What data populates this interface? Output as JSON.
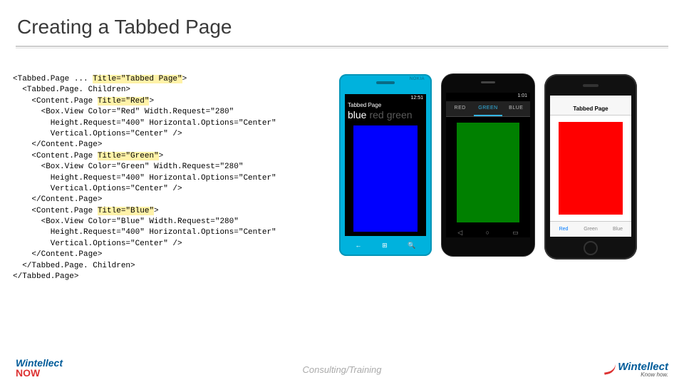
{
  "slide": {
    "title": "Creating a Tabbed Page"
  },
  "code": {
    "l1a": "<Tabbed.Page ... ",
    "l1b": "Title=\"Tabbed Page\"",
    "l1c": ">",
    "l2": "  <Tabbed.Page. Children>",
    "l3a": "    <Content.Page ",
    "l3b": "Title=\"Red\"",
    "l3c": ">",
    "l4": "      <Box.View Color=\"Red\" Width.Request=\"280\"",
    "l5": "        Height.Request=\"400\" Horizontal.Options=\"Center\"",
    "l6": "        Vertical.Options=\"Center\" />",
    "l7": "    </Content.Page>",
    "l8a": "    <Content.Page ",
    "l8b": "Title=\"Green\"",
    "l8c": ">",
    "l9": "      <Box.View Color=\"Green\" Width.Request=\"280\"",
    "l10": "        Height.Request=\"400\" Horizontal.Options=\"Center\"",
    "l11": "        Vertical.Options=\"Center\" />",
    "l12": "    </Content.Page>",
    "l13a": "    <Content.Page ",
    "l13b": "Title=\"Blue\"",
    "l13c": ">",
    "l14": "      <Box.View Color=\"Blue\" Width.Request=\"280\"",
    "l15": "        Height.Request=\"400\" Horizontal.Options=\"Center\"",
    "l16": "        Vertical.Options=\"Center\" />",
    "l17": "    </Content.Page>",
    "l18": "  </Tabbed.Page. Children>",
    "l19": "</Tabbed.Page>"
  },
  "wp": {
    "brand": "NOKIA",
    "time": "12:51",
    "title": "Tabbed Page",
    "tab_active": "blue",
    "tab_dim1": "red",
    "tab_dim2": "green",
    "nav_back": "←",
    "nav_home": "⊞",
    "nav_search": "🔍"
  },
  "android": {
    "time": "1:01",
    "tab1": "RED",
    "tab2": "GREEN",
    "tab3": "BLUE",
    "nav_back": "◁",
    "nav_home": "○",
    "nav_recent": "▭"
  },
  "iphone": {
    "carrier_time": "",
    "title": "Tabbed Page",
    "tab1": "Red",
    "tab2": "Green",
    "tab3": "Blue"
  },
  "footer": {
    "left_line1": "Wintellect",
    "left_line2": "NOW",
    "mid": "Consulting/Training",
    "right_line1": "Wintellect",
    "right_line2": "Know how."
  }
}
